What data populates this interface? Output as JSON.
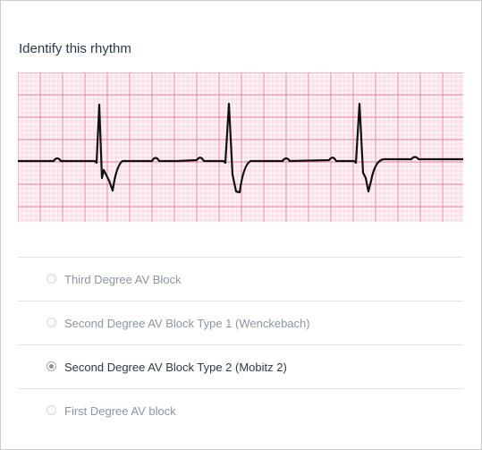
{
  "question": {
    "title": "Identify this rhythm"
  },
  "ecg": {
    "image_alt": "ECG rhythm strip",
    "grid_color": "#e46a8c",
    "trace_color": "#111111"
  },
  "answers": [
    {
      "label": "Third Degree AV Block",
      "selected": false
    },
    {
      "label": "Second Degree AV Block Type 1 (Wenckebach)",
      "selected": false
    },
    {
      "label": "Second Degree AV Block Type 2 (Mobitz 2)",
      "selected": true
    },
    {
      "label": "First Degree AV block",
      "selected": false
    }
  ],
  "colors": {
    "text": "#2d3b45",
    "muted": "#8b969e",
    "divider": "#dfe3e6"
  }
}
